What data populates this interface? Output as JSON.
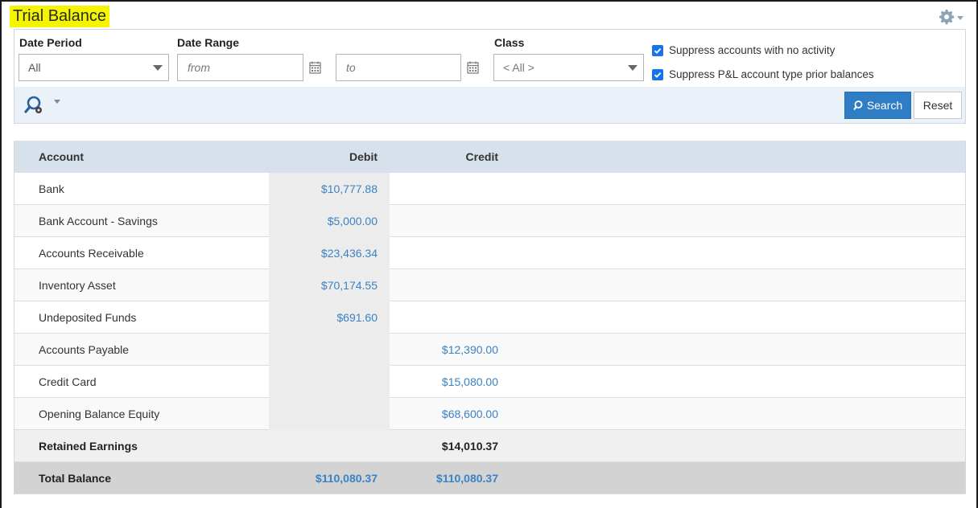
{
  "page": {
    "title": "Trial Balance"
  },
  "filters": {
    "date_period": {
      "label": "Date Period",
      "value": "All"
    },
    "date_range": {
      "label": "Date Range",
      "from_placeholder": "from",
      "to_placeholder": "to"
    },
    "class": {
      "label": "Class",
      "value": "< All >"
    },
    "suppress_no_activity": {
      "label": "Suppress accounts with no activity",
      "checked": true
    },
    "suppress_pl_prior": {
      "label": "Suppress P&L account type prior balances",
      "checked": true
    },
    "search_label": "Search",
    "reset_label": "Reset"
  },
  "table": {
    "headers": {
      "account": "Account",
      "debit": "Debit",
      "credit": "Credit"
    },
    "rows": [
      {
        "account": "Bank",
        "debit": "$10,777.88",
        "credit": ""
      },
      {
        "account": "Bank Account - Savings",
        "debit": "$5,000.00",
        "credit": ""
      },
      {
        "account": "Accounts Receivable",
        "debit": "$23,436.34",
        "credit": ""
      },
      {
        "account": "Inventory Asset",
        "debit": "$70,174.55",
        "credit": ""
      },
      {
        "account": "Undeposited Funds",
        "debit": "$691.60",
        "credit": ""
      },
      {
        "account": "Accounts Payable",
        "debit": "",
        "credit": "$12,390.00"
      },
      {
        "account": "Credit Card",
        "debit": "",
        "credit": "$15,080.00"
      },
      {
        "account": "Opening Balance Equity",
        "debit": "",
        "credit": "$68,600.00"
      }
    ],
    "retained": {
      "account": "Retained Earnings",
      "debit": "",
      "credit": "$14,010.37"
    },
    "total": {
      "account": "Total Balance",
      "debit": "$110,080.37",
      "credit": "$110,080.37"
    }
  },
  "colors": {
    "accent": "#2f7ec5",
    "link": "#3b82c4",
    "title_highlight": "#f5f500",
    "header_bg": "#d6e1eb"
  }
}
